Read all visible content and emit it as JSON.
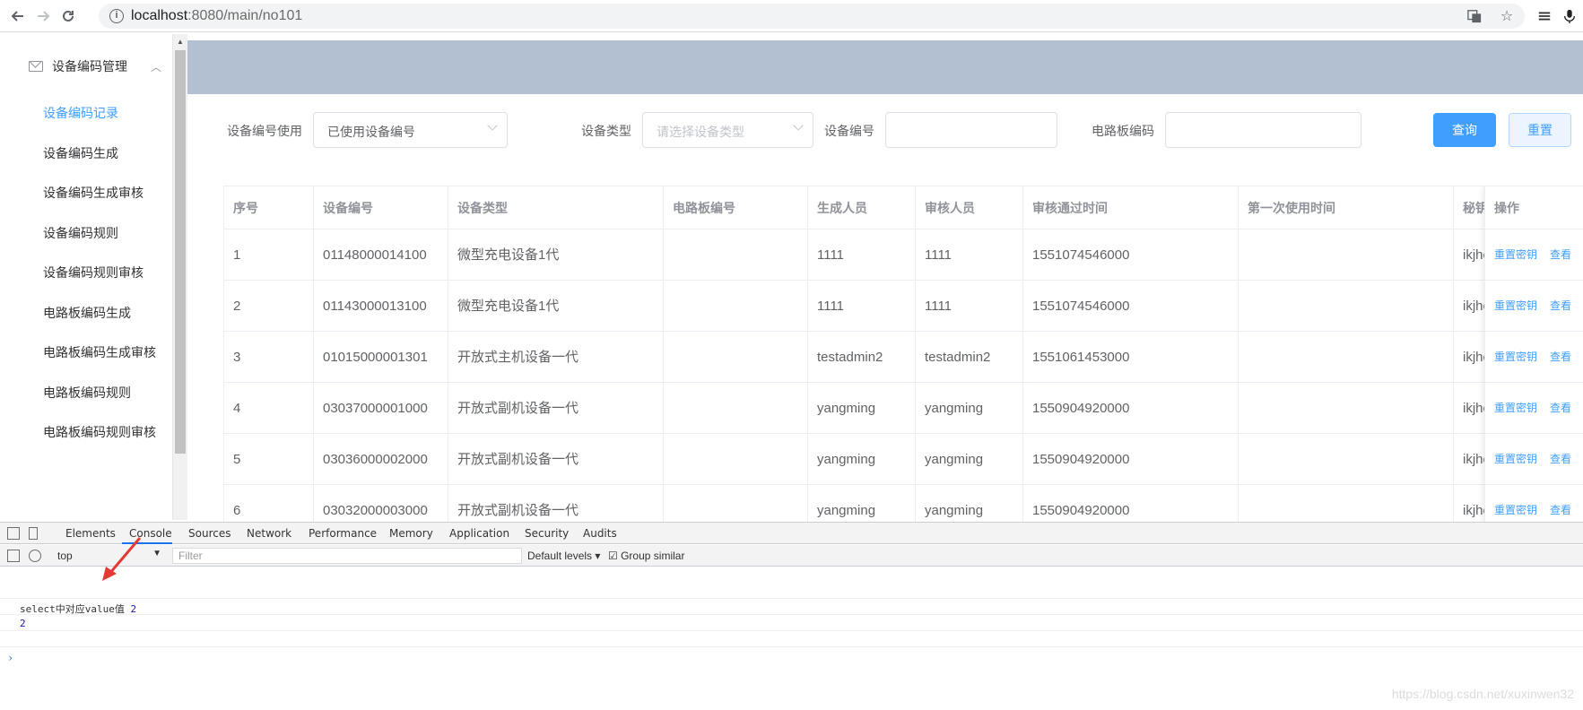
{
  "browser": {
    "url_host": "localhost",
    "url_rest": ":8080/main/no101"
  },
  "sidebar": {
    "group_title": "设备编码管理",
    "items": [
      {
        "label": "设备编码记录",
        "active": true
      },
      {
        "label": "设备编码生成",
        "active": false
      },
      {
        "label": "设备编码生成审核",
        "active": false
      },
      {
        "label": "设备编码规则",
        "active": false
      },
      {
        "label": "设备编码规则审核",
        "active": false
      },
      {
        "label": "电路板编码生成",
        "active": false
      },
      {
        "label": "电路板编码生成审核",
        "active": false
      },
      {
        "label": "电路板编码规则",
        "active": false
      },
      {
        "label": "电路板编码规则审核",
        "active": false
      }
    ]
  },
  "filters": {
    "usage_label": "设备编号使用",
    "usage_value": "已使用设备编号",
    "type_label": "设备类型",
    "type_placeholder": "请选择设备类型",
    "code_label": "设备编号",
    "board_label": "电路板编码",
    "query_button": "查询",
    "reset_button": "重置"
  },
  "table": {
    "headers": [
      "序号",
      "设备编号",
      "设备类型",
      "电路板编号",
      "生成人员",
      "审核人员",
      "审核通过时间",
      "第一次使用时间",
      "秘钥"
    ],
    "op_header": "操作",
    "op_reset": "重置密钥",
    "op_view": "查看",
    "rows": [
      [
        "1",
        "01148000014100",
        "微型充电设备1代",
        "",
        "1111",
        "1111",
        "1551074546000",
        "",
        "ikjho"
      ],
      [
        "2",
        "01143000013100",
        "微型充电设备1代",
        "",
        "1111",
        "1111",
        "1551074546000",
        "",
        "ikjho"
      ],
      [
        "3",
        "01015000001301",
        "开放式主机设备一代",
        "",
        "testadmin2",
        "testadmin2",
        "1551061453000",
        "",
        "ikjho"
      ],
      [
        "4",
        "03037000001000",
        "开放式副机设备一代",
        "",
        "yangming",
        "yangming",
        "1550904920000",
        "",
        "ikjho"
      ],
      [
        "5",
        "03036000002000",
        "开放式副机设备一代",
        "",
        "yangming",
        "yangming",
        "1550904920000",
        "",
        "ikjho"
      ],
      [
        "6",
        "03032000003000",
        "开放式副机设备一代",
        "",
        "yangming",
        "yangming",
        "1550904920000",
        "",
        "ikjho"
      ]
    ]
  },
  "devtools": {
    "tabs": [
      "Elements",
      "Console",
      "Sources",
      "Network",
      "Performance",
      "Memory",
      "Application",
      "Security",
      "Audits"
    ],
    "active_tab": "Console",
    "context": "top",
    "filter_placeholder": "Filter",
    "levels": "Default levels ▾",
    "group_similar": "Group similar",
    "log_line_text": "select中对应value值",
    "log_line_value": "2",
    "log_line2": "2"
  },
  "watermark": "https://blog.csdn.net/xuxinwen32"
}
